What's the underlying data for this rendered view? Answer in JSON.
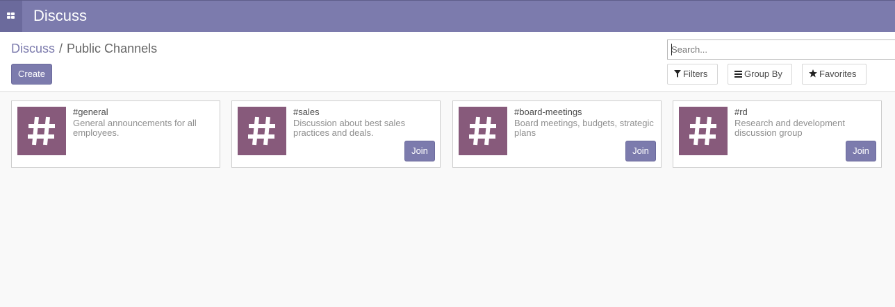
{
  "navbar": {
    "apps_icon": "grid-icon",
    "brand": "Discuss",
    "color": "#7c7bad"
  },
  "control_panel": {
    "breadcrumb": {
      "root": "Discuss",
      "separator": "/",
      "current": "Public Channels"
    },
    "create_label": "Create",
    "search": {
      "placeholder": "Search...",
      "value": ""
    },
    "filters_label": "Filters",
    "filters_icon": "filter-icon",
    "groupby_label": "Group By",
    "groupby_icon": "bars-icon",
    "favorites_label": "Favorites",
    "favorites_icon": "star-icon"
  },
  "channels": [
    {
      "name": "#general",
      "description": "General announcements for all employees.",
      "join_label": "",
      "icon": "hashtag-icon"
    },
    {
      "name": "#sales",
      "description": "Discussion about best sales practices and deals.",
      "join_label": "Join",
      "icon": "hashtag-icon"
    },
    {
      "name": "#board-meetings",
      "description": "Board meetings, budgets, strategic plans",
      "join_label": "Join",
      "icon": "hashtag-icon"
    },
    {
      "name": "#rd",
      "description": "Research and development discussion group",
      "join_label": "Join",
      "icon": "hashtag-icon"
    }
  ],
  "colors": {
    "primary": "#7c7bad",
    "avatar_bg": "#875a7b"
  }
}
